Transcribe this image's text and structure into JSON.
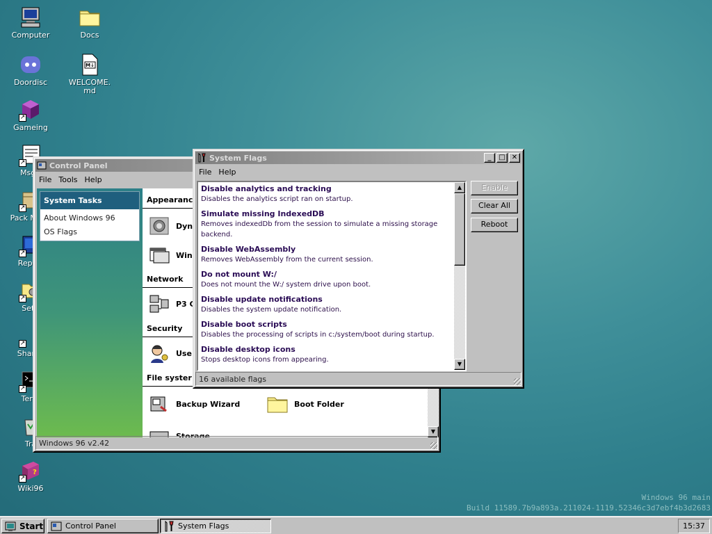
{
  "desktop": {
    "icons": [
      {
        "label": "Computer",
        "icon": "computer-icon"
      },
      {
        "label": "Docs",
        "icon": "folder-icon"
      },
      {
        "label": "Doordisc",
        "icon": "doordisc-icon"
      },
      {
        "label": "WELCOME.md",
        "icon": "markdown-file-icon"
      },
      {
        "label": "Gameing",
        "icon": "game-cube-icon"
      },
      {
        "label": "MsgR",
        "icon": "message-icon"
      },
      {
        "label": "Pack Mana",
        "icon": "package-icon"
      },
      {
        "label": "Report",
        "icon": "report-icon"
      },
      {
        "label": "Setti",
        "icon": "settings-icon"
      },
      {
        "label": "Share I",
        "icon": "share-icon"
      },
      {
        "label": "Term",
        "icon": "terminal-icon"
      },
      {
        "label": "Tra",
        "icon": "trash-icon"
      },
      {
        "label": "Wiki96",
        "icon": "wiki-book-icon"
      }
    ],
    "build_line1": "Windows 96 main",
    "build_line2": "Build 11589.7b9a893a.211024-1119.52346c3d7ebf4b3d2683"
  },
  "control_panel": {
    "title": "Control Panel",
    "menu": [
      "File",
      "Tools",
      "Help"
    ],
    "tasks_header": "System Tasks",
    "tasks": [
      "About Windows 96",
      "OS Flags"
    ],
    "sections": {
      "appearance": "Appearanc",
      "network": "Network",
      "security": "Security",
      "filesystem": "File syster"
    },
    "items": {
      "dynamic": "Dyn",
      "windows": "Win",
      "p3": "P3 C",
      "users": "Use",
      "backup": "Backup Wizard",
      "boot_folder": "Boot Folder",
      "storage": "Storage"
    },
    "status": "Windows 96 v2.42"
  },
  "system_flags": {
    "title": "System Flags",
    "menu": [
      "File",
      "Help"
    ],
    "flags": [
      {
        "title": "Disable analytics and tracking",
        "desc": "Disables the analytics script ran on startup."
      },
      {
        "title": "Simulate missing IndexedDB",
        "desc": "Removes indexedDb from the session to simulate a missing storage backend."
      },
      {
        "title": "Disable WebAssembly",
        "desc": "Removes WebAssembly from the current session."
      },
      {
        "title": "Do not mount W:/",
        "desc": "Does not mount the W:/ system drive upon boot."
      },
      {
        "title": "Disable update notifications",
        "desc": "Disables the system update notification."
      },
      {
        "title": "Disable boot scripts",
        "desc": "Disables the processing of scripts in c:/system/boot during startup."
      },
      {
        "title": "Disable desktop icons",
        "desc": "Stops desktop icons from appearing."
      }
    ],
    "buttons": {
      "enable": "Enable",
      "clear_all": "Clear All",
      "reboot": "Reboot"
    },
    "status": "16 available flags"
  },
  "taskbar": {
    "start": "Start",
    "tasks": [
      "Control Panel",
      "System Flags"
    ],
    "clock": "15:37"
  }
}
